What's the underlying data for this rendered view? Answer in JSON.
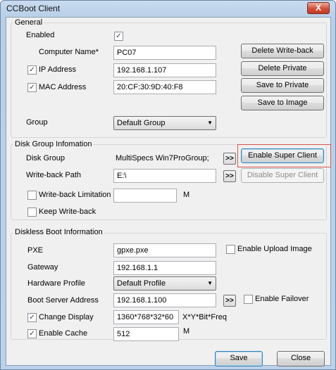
{
  "window": {
    "title": "CCBoot Client",
    "close_glyph": "X"
  },
  "general": {
    "legend": "General",
    "enabled_label": "Enabled",
    "enabled_checked": true,
    "computer_name_label": "Computer Name*",
    "computer_name_value": "PC07",
    "ip_label": "IP Address",
    "ip_checked": true,
    "ip_value": "192.168.1.107",
    "mac_label": "MAC Address",
    "mac_checked": true,
    "mac_value": "20:CF:30:9D:40:F8",
    "group_label": "Group",
    "group_value": "Default Group",
    "buttons": {
      "delete_writeback": "Delete Write-back",
      "delete_private": "Delete Private",
      "save_private": "Save to Private",
      "save_image": "Save to Image"
    }
  },
  "disk_group": {
    "legend": "Disk Group Infomation",
    "disk_group_label": "Disk Group",
    "disk_group_value": "MultiSpecs Win7ProGroup;",
    "writeback_path_label": "Write-back Path",
    "writeback_path_value": "E:\\",
    "browse_glyph": ">>",
    "writeback_limit_label": "Write-back Limitation",
    "writeback_limit_checked": false,
    "writeback_limit_value": "",
    "unit_m": "M",
    "keep_writeback_label": "Keep Write-back",
    "keep_writeback_checked": false,
    "enable_super_client": "Enable Super Client",
    "disable_super_client": "Disable Super Client"
  },
  "diskless": {
    "legend": "Diskless Boot Information",
    "pxe_label": "PXE",
    "pxe_value": "gpxe.pxe",
    "enable_upload_label": "Enable Upload Image",
    "enable_upload_checked": false,
    "gateway_label": "Gateway",
    "gateway_value": "192.168.1.1",
    "hw_profile_label": "Hardware Profile",
    "hw_profile_value": "Default Profile",
    "boot_server_label": "Boot Server Address",
    "boot_server_value": "192.168.1.100",
    "enable_failover_label": "Enable Failover",
    "enable_failover_checked": false,
    "change_display_label": "Change Display",
    "change_display_checked": true,
    "change_display_value": "1360*768*32*60",
    "display_format_hint": "X*Y*Bit*Freq",
    "enable_cache_label": "Enable Cache",
    "enable_cache_checked": true,
    "enable_cache_value": "512",
    "unit_m": "M"
  },
  "footer": {
    "save": "Save",
    "close": "Close"
  },
  "colors": {
    "highlight": "#d9534f",
    "title_bg": "#c9dbef",
    "client_bg": "#f0f0f0"
  }
}
